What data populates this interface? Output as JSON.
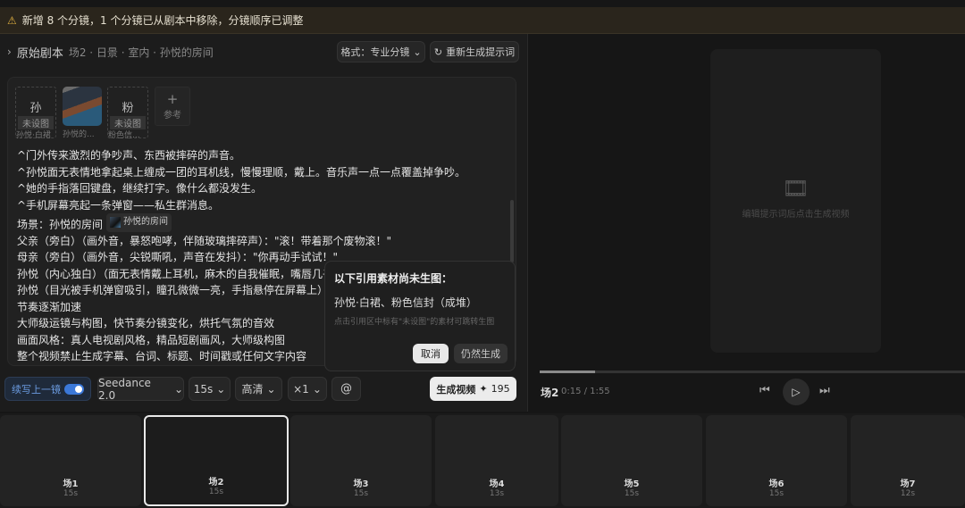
{
  "banner": {
    "icon": "warning-icon",
    "text": "新增 8 个分镜，1 个分镜已从剧本中移除，分镜顺序已调整"
  },
  "header": {
    "title": "原始剧本",
    "subtitle": "场2 · 日景 · 室内 · 孙悦的房间",
    "format_btn": "格式：专业分镜",
    "regen_btn": "重新生成提示词"
  },
  "refs": [
    {
      "char": "孙",
      "tag": "未设图",
      "name": "孙悦·白裙"
    },
    {
      "name": "孙悦的..."
    },
    {
      "char": "粉",
      "tag": "未设图",
      "name": "粉色信..."
    },
    {
      "add": "参考"
    }
  ],
  "script_lines": [
    "^门外传来激烈的争吵声、东西被摔碎的声音。",
    "^孙悦面无表情地拿起桌上缠成一团的耳机线，慢慢理顺，戴上。音乐声一点一点覆盖掉争吵。",
    "^她的手指落回键盘，继续打字。像什么都没发生。",
    "^手机屏幕亮起一条弹窗——私生群消息。"
  ],
  "scene_label": "场景：孙悦的房间",
  "scene_chip": "孙悦的房间",
  "script_lines2": [
    "父亲（旁白）（画外音，暴怒咆哮，伴随玻璃摔碎声）：\"滚！带着那个废物滚！\"",
    "母亲（旁白）（画外音，尖锐嘶吼，声音在发抖）：\"你再动手试试！\"",
    "孙悦（内心独白）（面无表情戴上耳机，麻木的自我催眠，嘴唇几乎",
    "孙悦（目光被手机弹窗吸引，瞳孔微微一亮，手指悬停在屏幕上）：",
    "节奏逐渐加速",
    "大师级运镜与构图，快节奏分镜变化，烘托气氛的音效",
    "画面风格：真人电视剧风格，精品短剧画风，大师级构图",
    "整个视频禁止生成字幕、台词、标题、时间戳或任何文字内容"
  ],
  "popover": {
    "title": "以下引用素材尚未生图：",
    "items": "孙悦·白裙、粉色信封（成堆）",
    "note": "点击引用区中标有\"未设图\"的素材可跳转生图",
    "cancel": "取消",
    "confirm": "仍然生成"
  },
  "toolbar": {
    "continue": "续写上一镜",
    "continue_on": true,
    "model": "Seedance 2.0",
    "duration": "15s",
    "quality": "高清",
    "count": "×1",
    "generate": "生成视频",
    "cost": "195"
  },
  "preview": {
    "hint": "编辑提示词后点击生成视频",
    "scene": "场2",
    "time": "0:15 / 1:55",
    "progress": 0.13
  },
  "scenes": [
    {
      "label": "场1",
      "dur": "15s"
    },
    {
      "label": "场2",
      "dur": "15s",
      "selected": true
    },
    {
      "label": "场3",
      "dur": "15s"
    },
    {
      "label": "场4",
      "dur": "13s"
    },
    {
      "label": "场5",
      "dur": "15s"
    },
    {
      "label": "场6",
      "dur": "15s"
    },
    {
      "label": "场7",
      "dur": "12s"
    }
  ]
}
